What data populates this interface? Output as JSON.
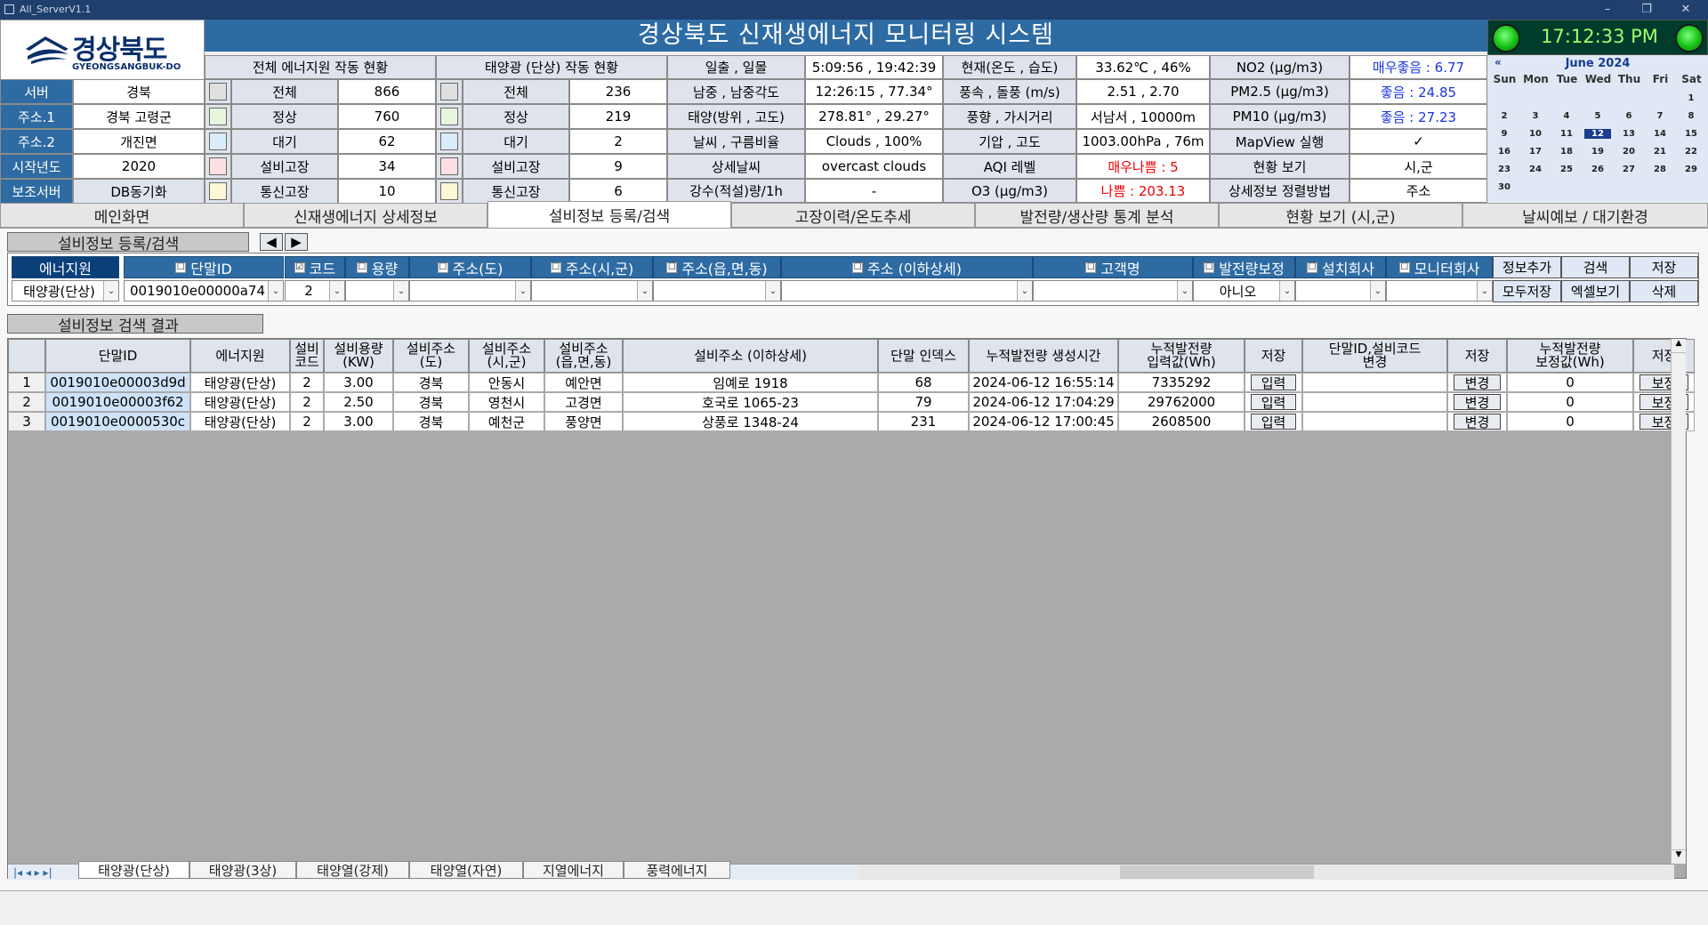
{
  "window": {
    "title": "All_ServerV1.1"
  },
  "brand": {
    "korean": "경상북도",
    "english": "GYEONGSANGBUK-DO"
  },
  "header": {
    "title": "경상북도 신재생에너지 모니터링 시스템"
  },
  "clock": {
    "time": "17:12:33 PM"
  },
  "calendar": {
    "prev": "«",
    "month_label": "June 2024",
    "day_names": [
      "Sun",
      "Mon",
      "Tue",
      "Wed",
      "Thu",
      "Fri",
      "Sat"
    ],
    "weeks": [
      [
        "",
        "",
        "",
        "",
        "",
        "",
        "1"
      ],
      [
        "2",
        "3",
        "4",
        "5",
        "6",
        "7",
        "8"
      ],
      [
        "9",
        "10",
        "11",
        "12",
        "13",
        "14",
        "15"
      ],
      [
        "16",
        "17",
        "18",
        "19",
        "20",
        "21",
        "22"
      ],
      [
        "23",
        "24",
        "25",
        "26",
        "27",
        "28",
        "29"
      ],
      [
        "30",
        "",
        "",
        "",
        "",
        "",
        ""
      ]
    ],
    "selected": "12"
  },
  "server": {
    "labels": [
      "서버",
      "주소.1",
      "주소.2",
      "시작년도",
      "보조서버"
    ],
    "values": [
      "경북",
      "경북 고령군",
      "개진면",
      "2020",
      "DB동기화"
    ]
  },
  "total": {
    "title": "전체 에너지원 작동 현황",
    "rows": [
      {
        "label": "전체",
        "value": "866"
      },
      {
        "label": "정상",
        "value": "760"
      },
      {
        "label": "대기",
        "value": "62"
      },
      {
        "label": "설비고장",
        "value": "34"
      },
      {
        "label": "통신고장",
        "value": "10"
      }
    ]
  },
  "solar": {
    "title": "태양광 (단상) 작동 현황",
    "rows": [
      {
        "label": "전체",
        "value": "236"
      },
      {
        "label": "정상",
        "value": "219"
      },
      {
        "label": "대기",
        "value": "2"
      },
      {
        "label": "설비고장",
        "value": "9"
      },
      {
        "label": "통신고장",
        "value": "6"
      }
    ]
  },
  "status_colors": [
    "#e0e0e0",
    "#e6f7de",
    "#d8ecfb",
    "#fce0e4",
    "#fdf7d6"
  ],
  "weather": {
    "l1": [
      "일출 , 일몰",
      "남중 , 남중각도",
      "태양(방위 , 고도)",
      "날씨 , 구름비율",
      "상세날씨",
      "강수(적설)량/1h"
    ],
    "v1": [
      "5:09:56 , 19:42:39",
      "12:26:15 , 77.34°",
      "278.81° , 29.27°",
      "Clouds , 100%",
      "overcast clouds",
      "-"
    ],
    "l2": [
      "현재(온도 , 습도)",
      "풍속 , 돌풍 (m/s)",
      "풍향 , 가시거리",
      "기압 , 고도",
      "AQI 레벨",
      "O3 (μg/m3)"
    ],
    "v2": [
      "33.62℃ , 46%",
      "2.51 , 2.70",
      "서남서 , 10000m",
      "1003.00hPa , 76m",
      "매우나쁨 : 5",
      "나쁨 : 203.13"
    ],
    "l3": [
      "NO2 (μg/m3)",
      "PM2.5 (μg/m3)",
      "PM10 (μg/m3)",
      "MapView 실행",
      "현황 보기",
      "상세정보 정렬방법"
    ],
    "v3": [
      "매우좋음 : 6.77",
      "좋음 : 24.85",
      "좋음 : 27.23",
      "✓",
      "시,군",
      "주소"
    ]
  },
  "tabs": [
    "메인화면",
    "신재생에너지 상세정보",
    "설비정보 등록/검색",
    "고장이력/온도추세",
    "발전량/생산량 통계 분석",
    "현황 보기 (시,군)",
    "날씨예보 / 대기환경"
  ],
  "register": {
    "section": "설비정보 등록/검색",
    "prev": "◀",
    "next": "▶",
    "filters": [
      {
        "label": "에너지원",
        "value": "태양광(단상)",
        "check": ""
      },
      {
        "label": "단말ID",
        "value": "0019010e00000a74",
        "check": "☐"
      },
      {
        "label": "코드",
        "value": "2",
        "check": "☑"
      },
      {
        "label": "용량",
        "value": "",
        "check": "☐"
      },
      {
        "label": "주소(도)",
        "value": "",
        "check": "☐"
      },
      {
        "label": "주소(시,군)",
        "value": "",
        "check": "☐"
      },
      {
        "label": "주소(읍,면,동)",
        "value": "",
        "check": "☐"
      },
      {
        "label": "주소 (이하상세)",
        "value": "",
        "check": "☐"
      },
      {
        "label": "고객명",
        "value": "",
        "check": "☐"
      },
      {
        "label": "발전량보정",
        "value": "아니오",
        "check": "☐"
      },
      {
        "label": "설치회사",
        "value": "",
        "check": "☐"
      },
      {
        "label": "모니터회사",
        "value": "",
        "check": "☐"
      }
    ],
    "buttons": [
      "정보추가",
      "검색",
      "저장",
      "모두저장",
      "엑셀보기",
      "삭제"
    ]
  },
  "results": {
    "section": "설비정보 검색 결과",
    "headers": [
      "단말ID",
      "에너지원",
      "설비\n코드",
      "설비용량\n(KW)",
      "설비주소\n(도)",
      "설비주소\n(시,군)",
      "설비주소\n(읍,면,동)",
      "설비주소 (이하상세)",
      "단말 인덱스",
      "누적발전량 생성시간",
      "누적발전량\n입력값(Wh)",
      "저장",
      "단말ID,설비코드\n변경",
      "저장",
      "누적발전량\n보정값(Wh)",
      "저장"
    ],
    "rows": [
      {
        "no": "1",
        "cells": [
          "0019010e00003d9d",
          "태양광(단상)",
          "2",
          "3.00",
          "경북",
          "안동시",
          "예안면",
          "임예로 1918",
          "68",
          "2024-06-12 16:55:14",
          "7335292",
          "입력",
          "",
          "변경",
          "0",
          "보정"
        ]
      },
      {
        "no": "2",
        "cells": [
          "0019010e00003f62",
          "태양광(단상)",
          "2",
          "2.50",
          "경북",
          "영천시",
          "고경면",
          "호국로 1065-23",
          "79",
          "2024-06-12 17:04:29",
          "29762000",
          "입력",
          "",
          "변경",
          "0",
          "보정"
        ]
      },
      {
        "no": "3",
        "cells": [
          "0019010e0000530c",
          "태양광(단상)",
          "2",
          "3.00",
          "경북",
          "예천군",
          "풍양면",
          "상풍로 1348-24",
          "231",
          "2024-06-12 17:00:45",
          "2608500",
          "입력",
          "",
          "변경",
          "0",
          "보정"
        ]
      }
    ]
  },
  "sheets": [
    "태양광(단상)",
    "태양광(3상)",
    "태양열(강제)",
    "태양열(자연)",
    "지열에너지",
    "풍력에너지"
  ],
  "sheet_nav": "|◂ ◂ ▸ ▸|"
}
